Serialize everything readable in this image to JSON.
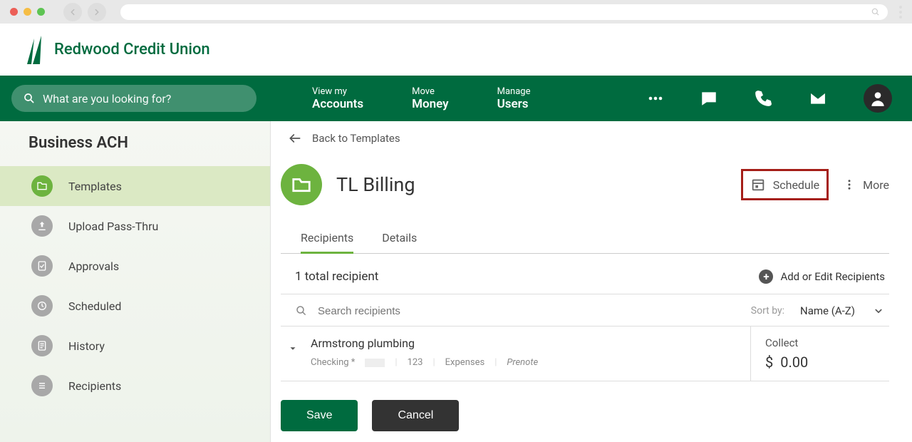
{
  "brand": {
    "name": "Redwood Credit Union"
  },
  "search": {
    "placeholder": "What are you looking for?"
  },
  "nav": {
    "accounts": {
      "sub": "View my",
      "main": "Accounts"
    },
    "money": {
      "sub": "Move",
      "main": "Money"
    },
    "users": {
      "sub": "Manage",
      "main": "Users"
    }
  },
  "sidebar": {
    "title": "Business ACH",
    "items": [
      {
        "label": "Templates"
      },
      {
        "label": "Upload Pass-Thru"
      },
      {
        "label": "Approvals"
      },
      {
        "label": "Scheduled"
      },
      {
        "label": "History"
      },
      {
        "label": "Recipients"
      }
    ]
  },
  "back": {
    "label": "Back to Templates"
  },
  "template": {
    "name": "TL Billing"
  },
  "actions": {
    "schedule": "Schedule",
    "more": "More"
  },
  "tabs": {
    "recipients": "Recipients",
    "details": "Details"
  },
  "recipients": {
    "total_label": "1 total recipient",
    "add_edit": "Add or Edit Recipients",
    "search_placeholder": "Search recipients",
    "sort_label": "Sort by:",
    "sort_value": "Name (A-Z)",
    "list": [
      {
        "name": "Armstrong plumbing",
        "account_label": "Checking *",
        "id": "123",
        "category": "Expenses",
        "status": "Prenote",
        "collect_label": "Collect",
        "currency": "$",
        "amount": "0.00"
      }
    ]
  },
  "buttons": {
    "save": "Save",
    "cancel": "Cancel"
  }
}
